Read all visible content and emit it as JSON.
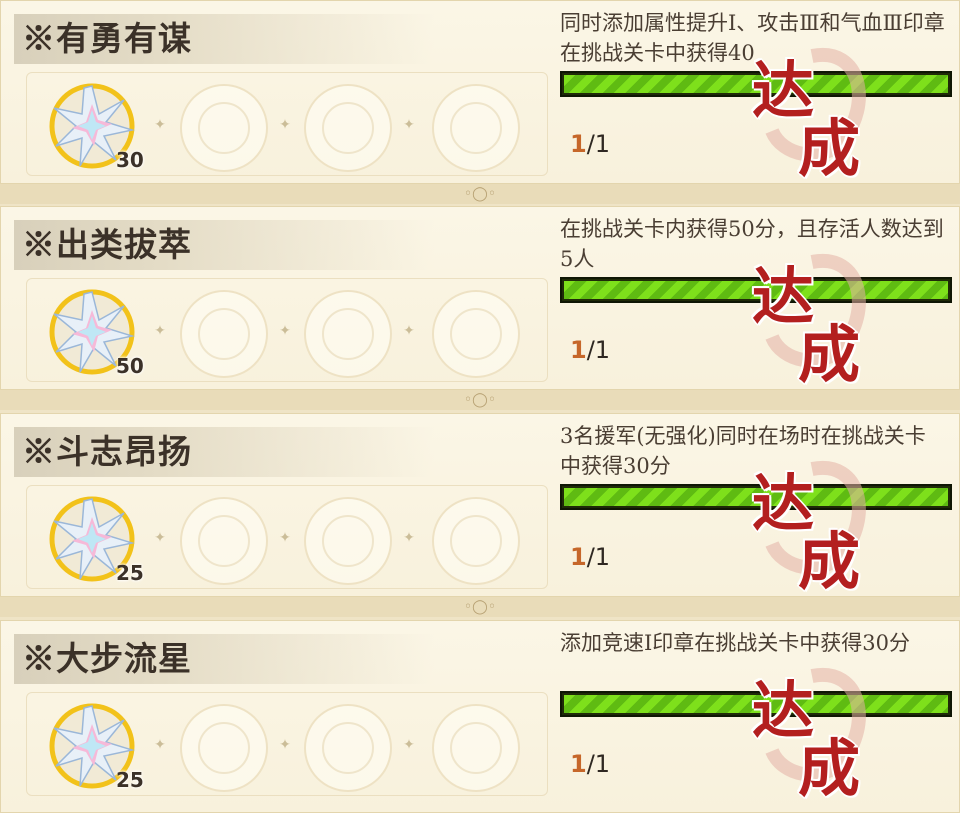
{
  "achievements": [
    {
      "title": "※有勇有谋",
      "description": "同时添加属性提升Ⅰ、攻击Ⅲ和气血Ⅲ印章在挑战关卡中获得40",
      "reward_count": "30",
      "progress_current": "1",
      "progress_total": "/1",
      "progress_fraction": 1.0,
      "stamp_chars": [
        "达",
        "成"
      ]
    },
    {
      "title": "※出类拔萃",
      "description": "在挑战关卡内获得50分，且存活人数达到5人",
      "reward_count": "50",
      "progress_current": "1",
      "progress_total": "/1",
      "progress_fraction": 1.0,
      "stamp_chars": [
        "达",
        "成"
      ]
    },
    {
      "title": "※斗志昂扬",
      "description": "3名援军(无强化)同时在场时在挑战关卡中获得30分",
      "reward_count": "25",
      "progress_current": "1",
      "progress_total": "/1",
      "progress_fraction": 1.0,
      "stamp_chars": [
        "达",
        "成"
      ]
    },
    {
      "title": "※大步流星",
      "description": "添加竞速Ⅰ印章在挑战关卡中获得30分",
      "reward_count": "25",
      "progress_current": "1",
      "progress_total": "/1",
      "progress_fraction": 1.0,
      "stamp_chars": [
        "达",
        "成"
      ]
    }
  ],
  "icons": {
    "reward": "crystal-star-medal-icon",
    "empty_slot": "empty-slot-icon",
    "divider": "ornament-divider-icon"
  },
  "colors": {
    "progress_fill": "#7ee01b",
    "stamp_red": "#b31f1f",
    "current_value": "#c6672a"
  }
}
